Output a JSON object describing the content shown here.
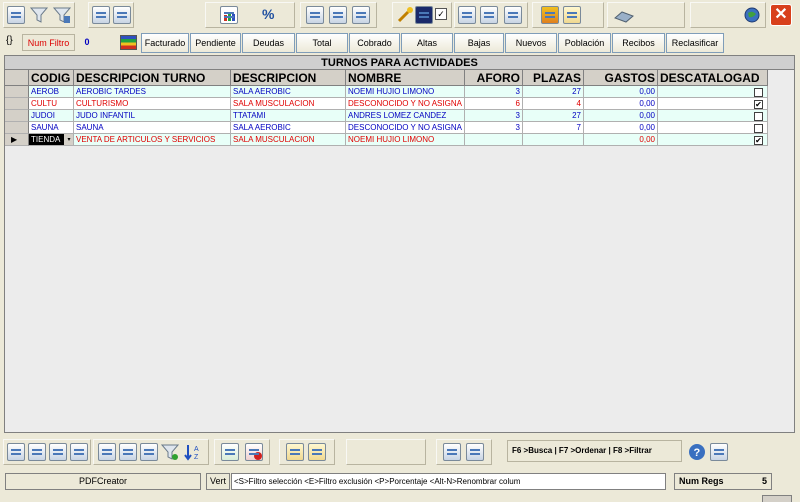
{
  "filter": {
    "brace": "{}",
    "label": "Num Filtro",
    "count": "0"
  },
  "tabs": [
    {
      "label": "Facturado"
    },
    {
      "label": "Pendiente"
    },
    {
      "label": "Deudas"
    },
    {
      "label": "Total"
    },
    {
      "label": "Cobrado"
    },
    {
      "label": "Altas"
    },
    {
      "label": "Bajas"
    },
    {
      "label": "Nuevos"
    },
    {
      "label": "Población"
    },
    {
      "label": "Recibos"
    },
    {
      "label": "Reclasificar"
    }
  ],
  "grid": {
    "title": "TURNOS PARA ACTIVIDADES",
    "headers": {
      "codigo": "CODIG",
      "descripcion_turno": "DESCRIPCION TURNO",
      "descripcion": "DESCRIPCION",
      "nombre": "NOMBRE",
      "aforo": "AFORO",
      "plazas": "PLAZAS",
      "gastos": "GASTOS",
      "descatalogado": "DESCATALOGAD"
    },
    "rows": [
      {
        "indicator": "",
        "codigo": "AEROB",
        "descripcion_turno": "AEROBIC TARDES",
        "descripcion": "SALA AEROBIC",
        "nombre": "NOEMI HUJIO LIMONO",
        "aforo": "3",
        "plazas": "27",
        "gastos": "0,00",
        "descatalogado": ""
      },
      {
        "indicator": "",
        "codigo": "CULTU",
        "descripcion_turno": "CULTURISMO",
        "descripcion": "SALA MUSCULACION",
        "nombre": "DESCONOCIDO Y NO ASIGNA",
        "aforo": "6",
        "plazas": "4",
        "gastos": "0,00",
        "descatalogado": "✔"
      },
      {
        "indicator": "",
        "codigo": "JUDOI",
        "descripcion_turno": "JUDO INFANTIL",
        "descripcion": "TTATAMI",
        "nombre": "ANDRES LOMEZ CANDEZ",
        "aforo": "3",
        "plazas": "27",
        "gastos": "0,00",
        "descatalogado": ""
      },
      {
        "indicator": "",
        "codigo": "SAUNA",
        "descripcion_turno": "SAUNA",
        "descripcion": "SALA AEROBIC",
        "nombre": "DESCONOCIDO Y NO ASIGNA",
        "aforo": "3",
        "plazas": "7",
        "gastos": "0,00",
        "descatalogado": ""
      },
      {
        "indicator": "▶",
        "codigo": "TIENDA",
        "descripcion_turno": "VENTA DE ARTICULOS Y SERVICIOS",
        "descripcion": "SALA MUSCULACION",
        "nombre": "NOEMI HUJIO LIMONO",
        "aforo": "",
        "plazas": "",
        "gastos": "0,00",
        "descatalogado": "✔"
      }
    ],
    "combo_arrow": "▾"
  },
  "bottom": {
    "hint": "F6 >Busca  |  F7 >Ordenar  |  F8 >Filtrar"
  },
  "status": {
    "printer": "PDFCreator",
    "vert": "Vert",
    "keys": "<S>Filtro selección <E>Filtro exclusión <P>Porcentaje <Alt-N>Renombrar colum",
    "regs_label": "Num Regs",
    "regs_value": "5"
  },
  "window": {
    "close": "✕"
  }
}
